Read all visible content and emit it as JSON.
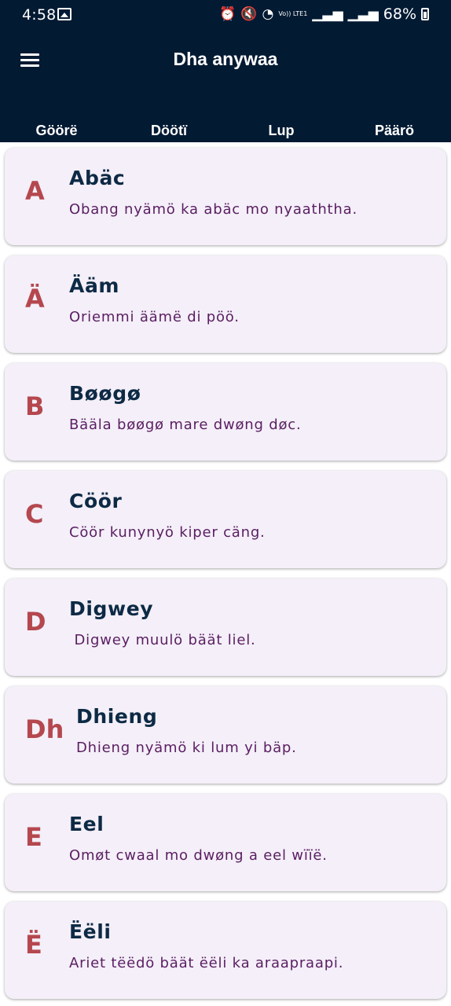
{
  "status_bar": {
    "time": "4:58",
    "battery": "68%",
    "network_label": "Vo)) LTE1",
    "icons": [
      "gallery-icon",
      "alarm-icon",
      "mute-icon",
      "wifi-icon",
      "signal-icon",
      "signal-icon",
      "battery-icon"
    ]
  },
  "app_bar": {
    "title": "Dha anywaa",
    "menu_icon": "hamburger-menu-icon",
    "background": "#031a33"
  },
  "tabs": [
    {
      "label": "Göörë",
      "active": false
    },
    {
      "label": "Döötï",
      "active": false
    },
    {
      "label": "Lup",
      "active": true
    },
    {
      "label": "Päärö",
      "active": false
    }
  ],
  "entries": [
    {
      "letter": "A",
      "word": "Abäc",
      "sentence": "Obang nyämö ka abäc mo nyaaththa."
    },
    {
      "letter": "Ä",
      "word": "Ääm",
      "sentence": "Oriemmi äämë di pöö."
    },
    {
      "letter": "B",
      "word": "Bøøgø",
      "sentence": "Bääla bøøgø mare dwøng døc."
    },
    {
      "letter": "C",
      "word": "Cöör",
      "sentence": "Cöör kunynyö kiper cäng."
    },
    {
      "letter": "D",
      "word": "Digwey",
      "sentence": " Digwey muulö bäät liel."
    },
    {
      "letter": "Dh",
      "word": "Dhieng",
      "sentence": "Dhieng nyämö ki lum yi bäp."
    },
    {
      "letter": "E",
      "word": "Eel",
      "sentence": "Omøt cwaal mo dwøng a eel wïïë."
    },
    {
      "letter": "Ë",
      "word": "Ëëli",
      "sentence": "Ariet tëëdö bäät ëëli ka araapraapi."
    }
  ],
  "colors": {
    "letter": "#b5474f",
    "word": "#0d2a45",
    "sentence": "#5a1e62",
    "card": "#f4eff8"
  }
}
